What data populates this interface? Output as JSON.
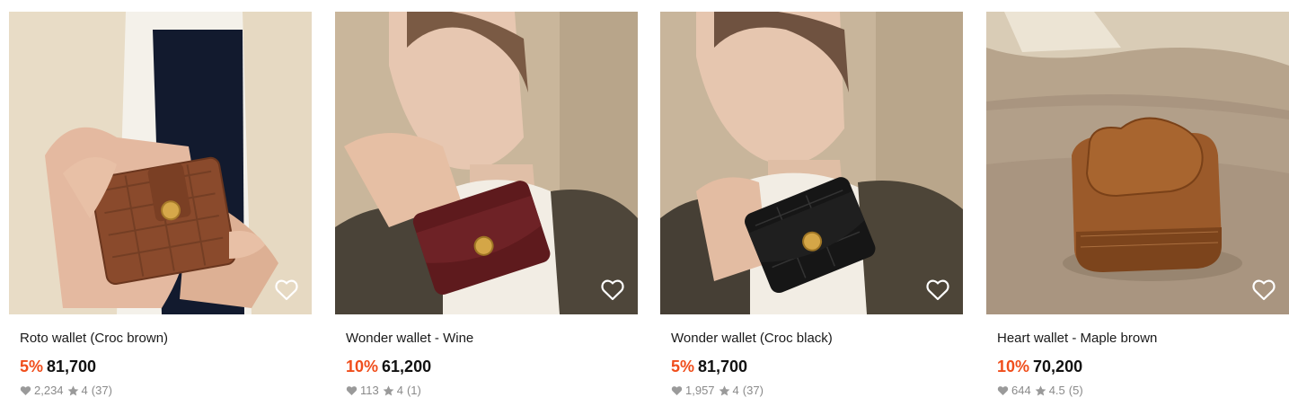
{
  "products": [
    {
      "name": "Roto wallet (Croc brown)",
      "discount": "5%",
      "price": "81,700",
      "likes": "2,234",
      "rating": "4",
      "reviews": "(37)",
      "wishlist_icon": "heart-outline-icon",
      "colors": {
        "bg": "#e9e1d3",
        "product": "#8a4a2c"
      }
    },
    {
      "name": "Wonder wallet - Wine",
      "discount": "10%",
      "price": "61,200",
      "likes": "113",
      "rating": "4",
      "reviews": "(1)",
      "wishlist_icon": "heart-outline-icon",
      "colors": {
        "bg": "#c7b49a",
        "product": "#5e1a1d"
      }
    },
    {
      "name": "Wonder wallet (Croc black)",
      "discount": "5%",
      "price": "81,700",
      "likes": "1,957",
      "rating": "4",
      "reviews": "(37)",
      "wishlist_icon": "heart-outline-icon",
      "colors": {
        "bg": "#c9b79d",
        "product": "#151515"
      }
    },
    {
      "name": "Heart wallet - Maple brown",
      "discount": "10%",
      "price": "70,200",
      "likes": "644",
      "rating": "4.5",
      "reviews": "(5)",
      "wishlist_icon": "heart-outline-icon",
      "colors": {
        "bg": "#bfae97",
        "product": "#9b5a2a"
      }
    }
  ],
  "accent_color": "#f04e1c"
}
